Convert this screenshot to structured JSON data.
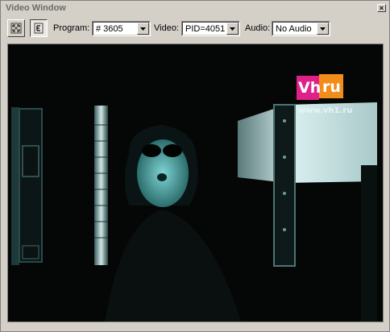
{
  "window": {
    "title": "Video Window",
    "close_symbol": "×"
  },
  "toolbar": {
    "program_label": "Program:",
    "program_value": "# 3605",
    "video_label": "Video:",
    "video_value": "PID=4051",
    "audio_label": "Audio:",
    "audio_value": "No Audio"
  },
  "video": {
    "logo_text_left": "Vh",
    "logo_text_right": "ru",
    "logo_url": "www.vh1.ru",
    "logo_colors": {
      "pink": "#e0208a",
      "orange": "#f28c1a"
    }
  },
  "icons": [
    "fullscreen-icon",
    "e-mode-icon",
    "dropdown-arrow-icon",
    "close-icon"
  ]
}
